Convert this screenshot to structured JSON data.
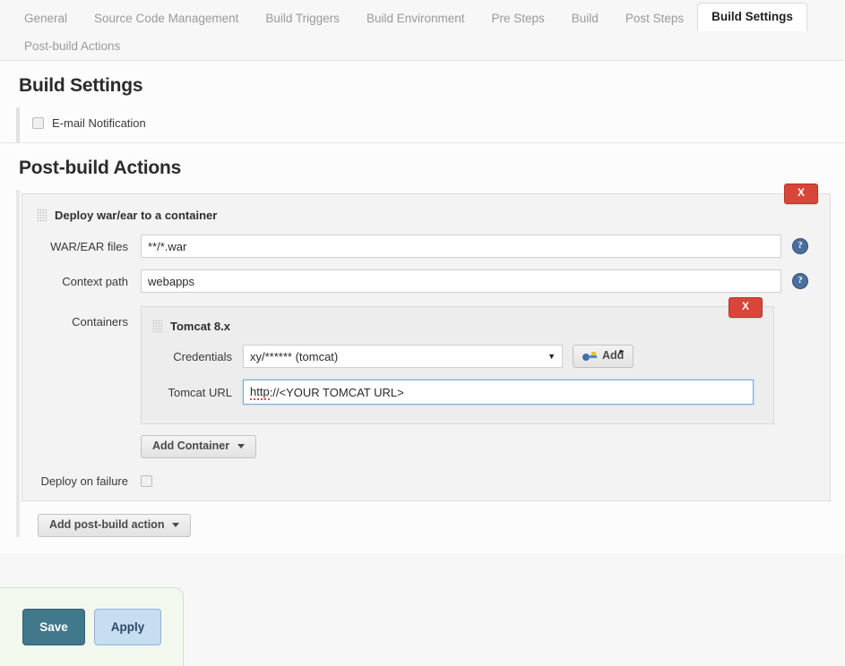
{
  "tabs": {
    "row1": [
      {
        "label": "General",
        "active": false
      },
      {
        "label": "Source Code Management",
        "active": false
      },
      {
        "label": "Build Triggers",
        "active": false
      },
      {
        "label": "Build Environment",
        "active": false
      },
      {
        "label": "Pre Steps",
        "active": false
      },
      {
        "label": "Build",
        "active": false
      },
      {
        "label": "Post Steps",
        "active": false
      },
      {
        "label": "Build Settings",
        "active": true
      }
    ],
    "row2": [
      {
        "label": "Post-build Actions",
        "active": false
      }
    ]
  },
  "build_settings": {
    "heading": "Build Settings",
    "email_notification_label": "E-mail Notification",
    "email_notification_checked": false
  },
  "post_build": {
    "heading": "Post-build Actions",
    "delete_label": "X",
    "deploy_panel": {
      "title": "Deploy war/ear to a container",
      "war_label": "WAR/EAR files",
      "war_value": "**/*.war",
      "context_label": "Context path",
      "context_value": "webapps",
      "help_glyph": "?",
      "containers_label": "Containers",
      "container": {
        "title": "Tomcat 8.x",
        "credentials_label": "Credentials",
        "credentials_value": "xy/****** (tomcat)",
        "add_credentials_label": "Add",
        "url_label": "Tomcat URL",
        "url_scheme": "http",
        "url_rest": "://<YOUR TOMCAT URL>"
      },
      "add_container_label": "Add Container",
      "deploy_on_failure_label": "Deploy on failure",
      "deploy_on_failure_checked": false
    },
    "add_post_build_action_label": "Add post-build action"
  },
  "footer": {
    "save_label": "Save",
    "apply_label": "Apply"
  },
  "colors": {
    "delete_red": "#d8453a",
    "save_teal": "#41788b",
    "apply_blue": "#c7ddf2",
    "help_blue": "#4a6f9e",
    "footer_green": "#f3f8ee"
  }
}
